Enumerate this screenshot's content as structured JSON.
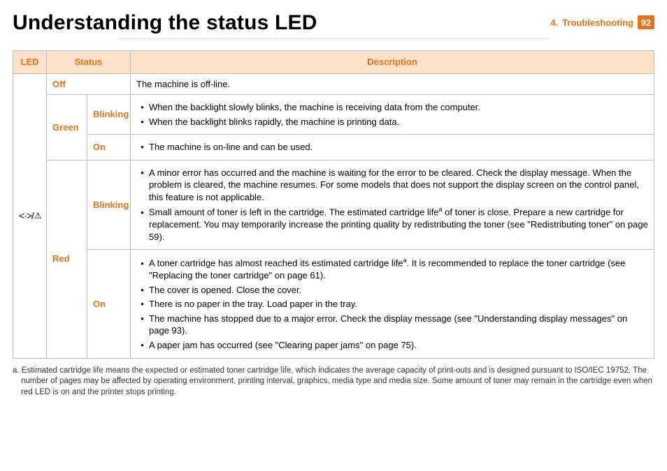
{
  "header": {
    "title": "Understanding the status LED",
    "breadcrumb_prefix": "4.",
    "breadcrumb_section": "Troubleshooting",
    "page_number": "92"
  },
  "table": {
    "headers": {
      "led": "LED",
      "status": "Status",
      "description": "Description"
    },
    "off": {
      "label": "Off",
      "desc": "The machine is off-line."
    },
    "green": {
      "label": "Green",
      "blinking": {
        "label": "Blinking",
        "items": [
          "When the backlight slowly blinks, the machine is receiving data from the computer.",
          "When the backlight blinks rapidly, the machine is printing data."
        ]
      },
      "on": {
        "label": "On",
        "items": [
          "The machine is on-line and can be used."
        ]
      }
    },
    "red": {
      "label": "Red",
      "blinking": {
        "label": "Blinking",
        "item1": "A minor error has occurred and the machine is waiting for the error to be cleared. Check the display message. When the problem is cleared, the machine resumes. For some models that does not support the display screen on the control panel, this feature is not applicable.",
        "item2a": "Small amount of toner is left in the cartridge. The estimated cartridge life",
        "item2b": " of toner is close. Prepare a new cartridge for replacement. You may temporarily increase the printing quality by redistributing the toner (see \"Redistributing toner\" on page 59)."
      },
      "on": {
        "label": "On",
        "item1a": "A toner cartridge has almost reached its estimated cartridge life",
        "item1b": ". It is recommended to replace the toner cartridge (see \"Replacing the toner cartridge\" on page 61).",
        "item2": "The cover is opened. Close the cover.",
        "item3": "There is no paper in the tray. Load paper in the tray.",
        "item4": "The machine has stopped due to a major error. Check the display message (see \"Understanding display messages\" on page 93).",
        "item5": "A paper jam has occurred (see \"Clearing paper jams\" on page 75)."
      }
    }
  },
  "footnote": {
    "marker": "a.",
    "text": "Estimated cartridge life means the expected or estimated toner cartridge life, which indicates the average capacity of print-outs and is designed pursuant to ISO/IEC 19752. The number of pages may be affected by operating environment, printing interval, graphics, media type and media size. Some amount of toner may remain in the cartridge even when red LED is on and the printer stops printing."
  },
  "sup": "a"
}
